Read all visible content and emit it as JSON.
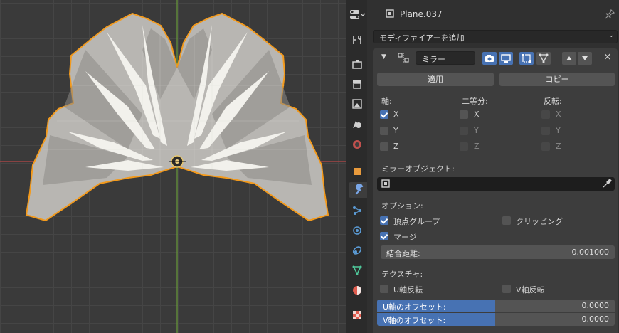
{
  "colors": {
    "accent": "#4772b3",
    "outline": "#f39a1c",
    "x_axis": "#b84848",
    "y_axis": "#6a9a3a"
  },
  "viewport": {
    "name": "3d-viewport"
  },
  "properties": {
    "object_name": "Plane.037",
    "add_modifier": "モディファイアーを追加",
    "modifier": {
      "name": "ミラー",
      "apply": "適用",
      "copy": "コピー",
      "axis_header": "軸:",
      "bisect_header": "二等分:",
      "flip_header": "反転:",
      "axis_x": "X",
      "axis_y": "Y",
      "axis_z": "Z",
      "bisect_x": "X",
      "bisect_y": "Y",
      "bisect_z": "Z",
      "flip_x": "X",
      "flip_y": "Y",
      "flip_z": "Z",
      "mirror_object_label": "ミラーオブジェクト:",
      "options_label": "オプション:",
      "vertex_groups": "頂点グループ",
      "clipping": "クリッピング",
      "merge": "マージ",
      "merge_distance_label": "結合距離:",
      "merge_distance_value": "0.001000",
      "textures_label": "テクスチャ:",
      "flip_u": "U軸反転",
      "flip_v": "V軸反転",
      "u_offset_label": "U軸のオフセット:",
      "u_offset_value": "0.0000",
      "v_offset_label": "V軸のオフセット:",
      "v_offset_value": "0.0000",
      "checks": {
        "axis_x": true,
        "axis_y": false,
        "axis_z": false,
        "vertex_groups": true,
        "clipping": false,
        "merge": true,
        "flip_u": false,
        "flip_v": false
      }
    }
  }
}
